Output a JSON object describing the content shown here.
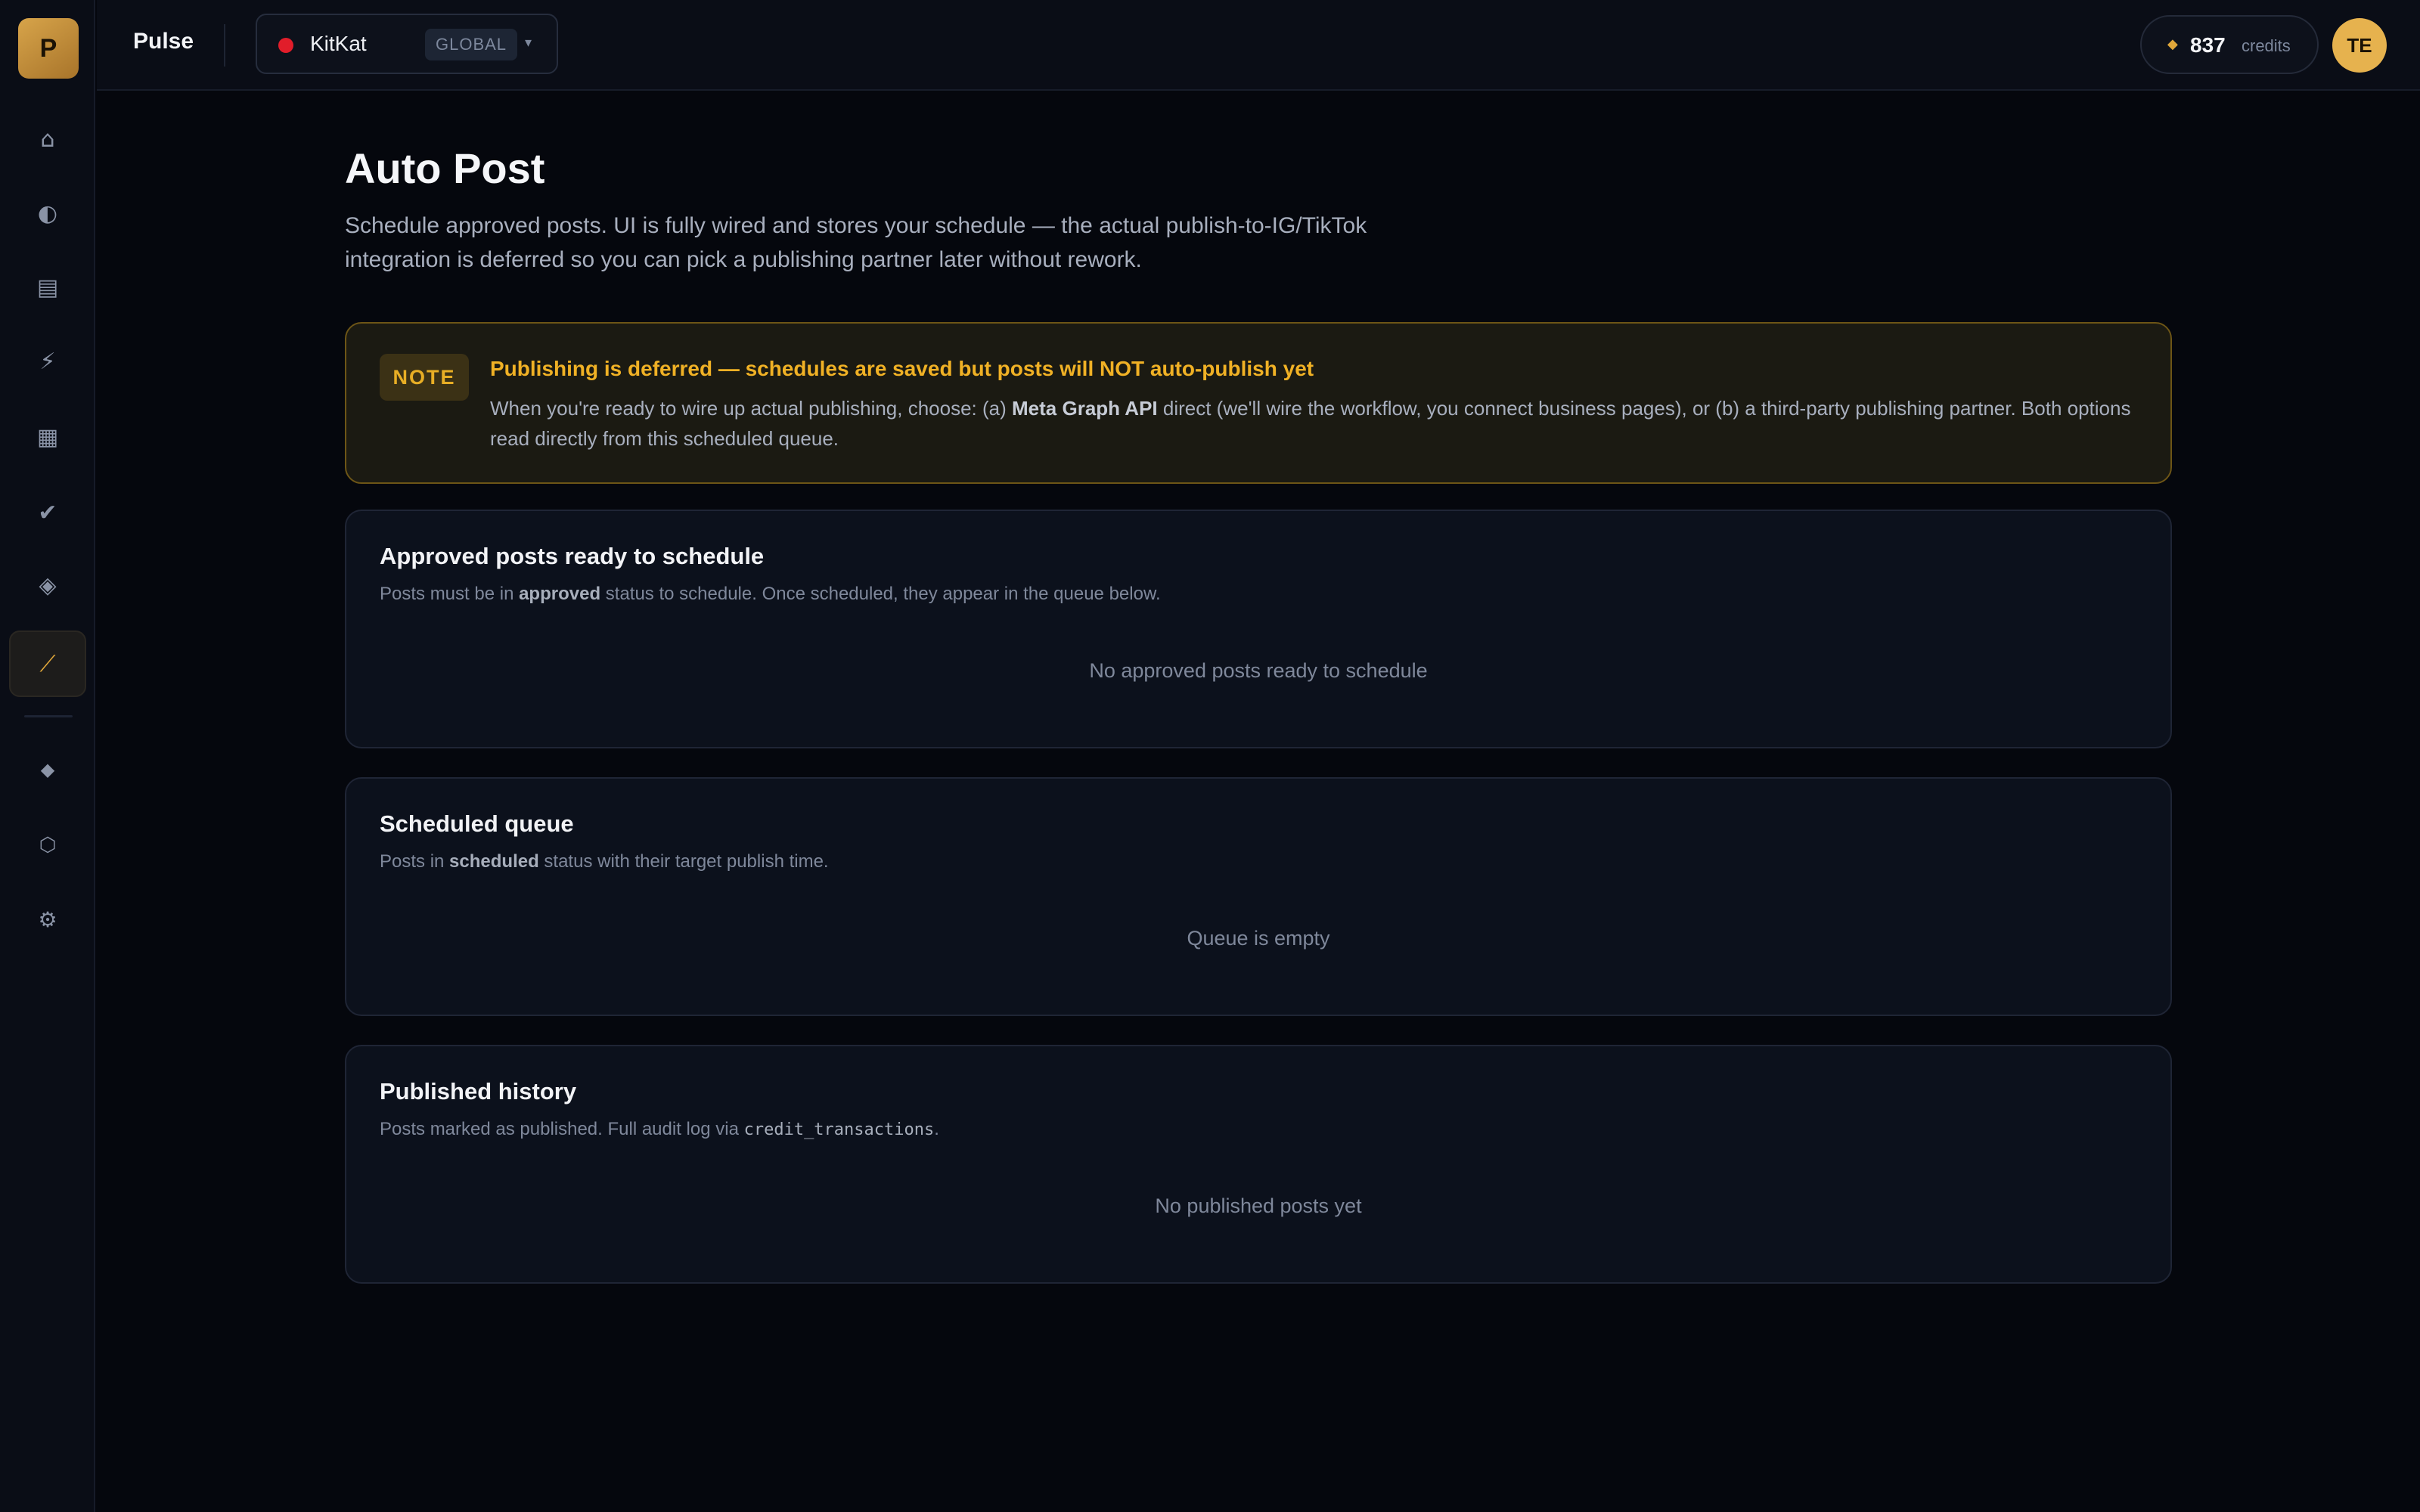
{
  "sidebar": {
    "logo_letter": "P",
    "items": [
      {
        "icon": "home-icon",
        "glyph": "⌂"
      },
      {
        "icon": "contrast-icon",
        "glyph": "◐"
      },
      {
        "icon": "document-icon",
        "glyph": "▤"
      },
      {
        "icon": "lightning-icon",
        "glyph": "⚡"
      },
      {
        "icon": "grid-icon",
        "glyph": "▦"
      },
      {
        "icon": "check-icon",
        "glyph": "✔"
      },
      {
        "icon": "layers-icon",
        "glyph": "◈"
      },
      {
        "icon": "arrow-diagonal-icon",
        "glyph": "⟋",
        "active": true
      },
      {
        "icon": "diamond-icon",
        "glyph": "◆"
      },
      {
        "icon": "hexagon-icon",
        "glyph": "⬡"
      },
      {
        "icon": "gear-icon",
        "glyph": "⚙"
      }
    ]
  },
  "header": {
    "brand": "Pulse",
    "workspace": {
      "name": "KitKat",
      "badge": "GLOBAL",
      "caret": "▾"
    },
    "credits": {
      "icon": "◆",
      "amount": "837",
      "label": "credits"
    },
    "avatar_initials": "TE"
  },
  "main": {
    "title": "Auto Post",
    "subtitle": "Schedule approved posts. UI is fully wired and stores your schedule — the actual publish-to-IG/TikTok integration is deferred so you can pick a publishing partner later without rework.",
    "note": {
      "tag": "NOTE",
      "title": "Publishing is deferred — schedules are saved but posts will NOT auto-publish yet",
      "body_prefix": "When you're ready to wire up actual publishing, choose: (a) ",
      "body_bold": "Meta Graph API",
      "body_suffix": " direct (we'll wire the workflow, you connect business pages), or (b) a third-party publishing partner. Both options read directly from this scheduled queue."
    },
    "cards": [
      {
        "title": "Approved posts ready to schedule",
        "desc_prefix": "Posts must be in ",
        "desc_bold": "approved",
        "desc_suffix": " status to schedule. Once scheduled, they appear in the queue below.",
        "empty": "No approved posts ready to schedule"
      },
      {
        "title": "Scheduled queue",
        "desc_prefix": "Posts in ",
        "desc_bold": "scheduled",
        "desc_suffix": " status with their target publish time.",
        "empty": "Queue is empty"
      },
      {
        "title": "Published history",
        "desc_prefix": "Posts marked as published. Full audit log via ",
        "desc_code": "credit_transactions",
        "desc_suffix": ".",
        "empty": "No published posts yet"
      }
    ]
  }
}
